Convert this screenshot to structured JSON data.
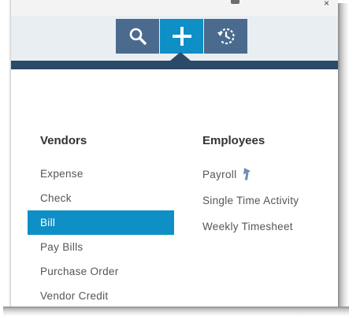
{
  "toolbar": {
    "buttons": [
      {
        "icon": "search-icon",
        "active": false
      },
      {
        "icon": "plus-icon",
        "active": true
      },
      {
        "icon": "recent-history-icon",
        "active": false
      }
    ]
  },
  "create_menu": {
    "vendors": {
      "header": "Vendors",
      "items": [
        "Expense",
        "Check",
        "Bill",
        "Pay Bills",
        "Purchase Order",
        "Vendor Credit"
      ],
      "highlighted": "Bill"
    },
    "employees": {
      "header": "Employees",
      "items": [
        "Payroll",
        "Single Time Activity",
        "Weekly Timesheet"
      ],
      "payroll_icon": "upgrade-arrow-icon"
    }
  },
  "colors": {
    "toolbar_button": "#4b6b8e",
    "toolbar_active": "#0e8fc6",
    "navy_bar": "#2a4a68",
    "highlight": "#0e8fc6",
    "header_text": "#333333",
    "item_text": "#555555"
  }
}
